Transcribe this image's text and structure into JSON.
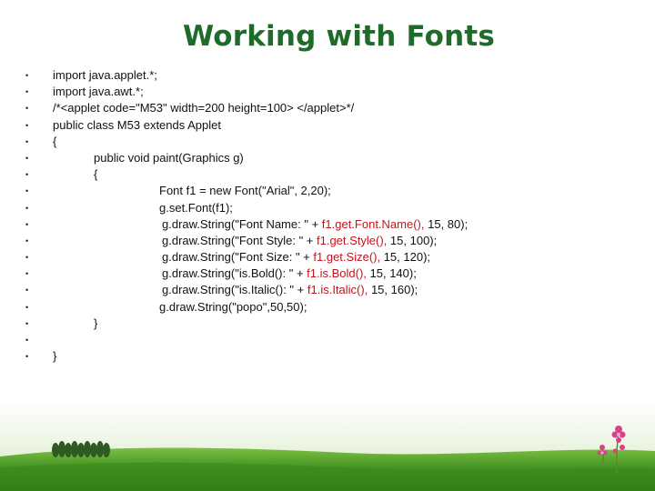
{
  "title": "Working with Fonts",
  "code_lines": [
    {
      "indent": 0,
      "parts": [
        {
          "t": "import java.applet.*;"
        }
      ]
    },
    {
      "indent": 0,
      "parts": [
        {
          "t": "import java.awt.*;"
        }
      ]
    },
    {
      "indent": 0,
      "parts": [
        {
          "t": "/*<applet code=\"M53\" width=200 height=100> </applet>*/"
        }
      ]
    },
    {
      "indent": 0,
      "parts": [
        {
          "t": "public class M53 extends Applet"
        }
      ]
    },
    {
      "indent": 0,
      "parts": [
        {
          "t": "{"
        }
      ]
    },
    {
      "indent": 1,
      "parts": [
        {
          "t": "public void paint(Graphics g)"
        }
      ]
    },
    {
      "indent": 1,
      "parts": [
        {
          "t": "{"
        }
      ]
    },
    {
      "indent": 2,
      "parts": [
        {
          "t": "Font f1 = new Font(\"Arial\", 2,20);"
        }
      ]
    },
    {
      "indent": 2,
      "parts": [
        {
          "t": "g.set.Font(f1);"
        }
      ]
    },
    {
      "indent": 3,
      "parts": [
        {
          "t": "g.draw.String(\"Font Name: \" + "
        },
        {
          "t": "f1.get.Font.Name(),",
          "red": true
        },
        {
          "t": " 15, 80);"
        }
      ]
    },
    {
      "indent": 3,
      "parts": [
        {
          "t": "g.draw.String(\"Font Style: \" + "
        },
        {
          "t": "f1.get.Style(),",
          "red": true
        },
        {
          "t": " 15, 100);"
        }
      ]
    },
    {
      "indent": 3,
      "parts": [
        {
          "t": "g.draw.String(\"Font Size: \" + "
        },
        {
          "t": "f1.get.Size(),",
          "red": true
        },
        {
          "t": " 15, 120);"
        }
      ]
    },
    {
      "indent": 3,
      "parts": [
        {
          "t": "g.draw.String(\"is.Bold(): \" + "
        },
        {
          "t": "f1.is.Bold(),",
          "red": true
        },
        {
          "t": " 15, 140);"
        }
      ]
    },
    {
      "indent": 3,
      "parts": [
        {
          "t": "g.draw.String(\"is.Italic(): \" + "
        },
        {
          "t": "f1.is.Italic(),",
          "red": true
        },
        {
          "t": " 15, 160);"
        }
      ]
    },
    {
      "indent": 2,
      "parts": [
        {
          "t": "g.draw.String(\"popo\",50,50);"
        }
      ]
    },
    {
      "indent": 1,
      "parts": [
        {
          "t": "}"
        }
      ]
    },
    {
      "indent": 0,
      "parts": [
        {
          "t": ""
        }
      ]
    },
    {
      "indent": 0,
      "parts": [
        {
          "t": "}"
        }
      ]
    }
  ],
  "bullet_glyph": "•",
  "colors": {
    "title": "#1e6b2a",
    "highlight": "#c0161b",
    "sky_top": "#ffffff",
    "grass": "#3f8f1f"
  }
}
